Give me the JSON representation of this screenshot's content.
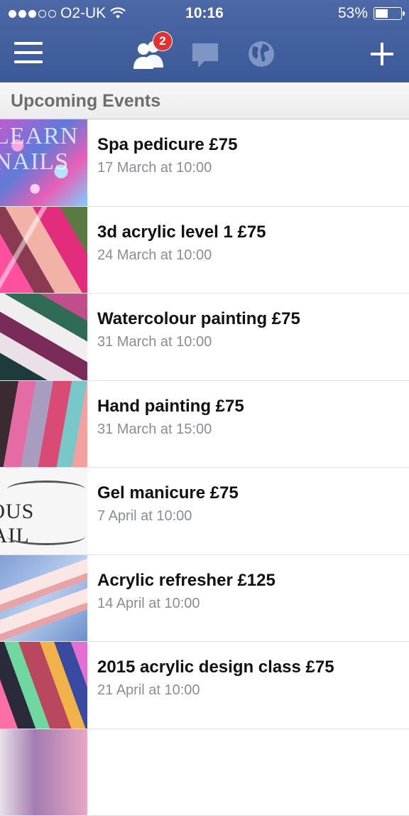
{
  "status_bar": {
    "carrier": "O2-UK",
    "time": "10:16",
    "battery": "53%",
    "battery_level": 0.53,
    "signal_bars_filled": 3,
    "signal_bars_total": 5
  },
  "nav": {
    "friend_requests_badge": "2",
    "icons": [
      "menu-icon",
      "friends-icon",
      "messages-icon",
      "globe-icon",
      "plus-icon"
    ]
  },
  "section": {
    "title": "Upcoming Events"
  },
  "events": [
    {
      "name": "Spa pedicure £75",
      "date": "17 March at 10:00",
      "thumb_text": "LEARN NAILS"
    },
    {
      "name": "3d acrylic level 1 £75",
      "date": "24 March at 10:00"
    },
    {
      "name": "Watercolour painting £75",
      "date": "31 March at 10:00"
    },
    {
      "name": "Hand painting £75",
      "date": "31 March at 15:00"
    },
    {
      "name": "Gel manicure £75",
      "date": "7 April at 10:00",
      "thumb_text": "EOUS NAIL"
    },
    {
      "name": "Acrylic refresher £125",
      "date": "14 April at 10:00"
    },
    {
      "name": "2015 acrylic design class £75",
      "date": "21 April at 10:00"
    },
    {
      "name": "",
      "date": ""
    }
  ],
  "colors": {
    "nav_bg": "#3b5998",
    "badge": "#e0332f",
    "date_text": "#8a8d93",
    "header_text": "#6d6d6d"
  }
}
